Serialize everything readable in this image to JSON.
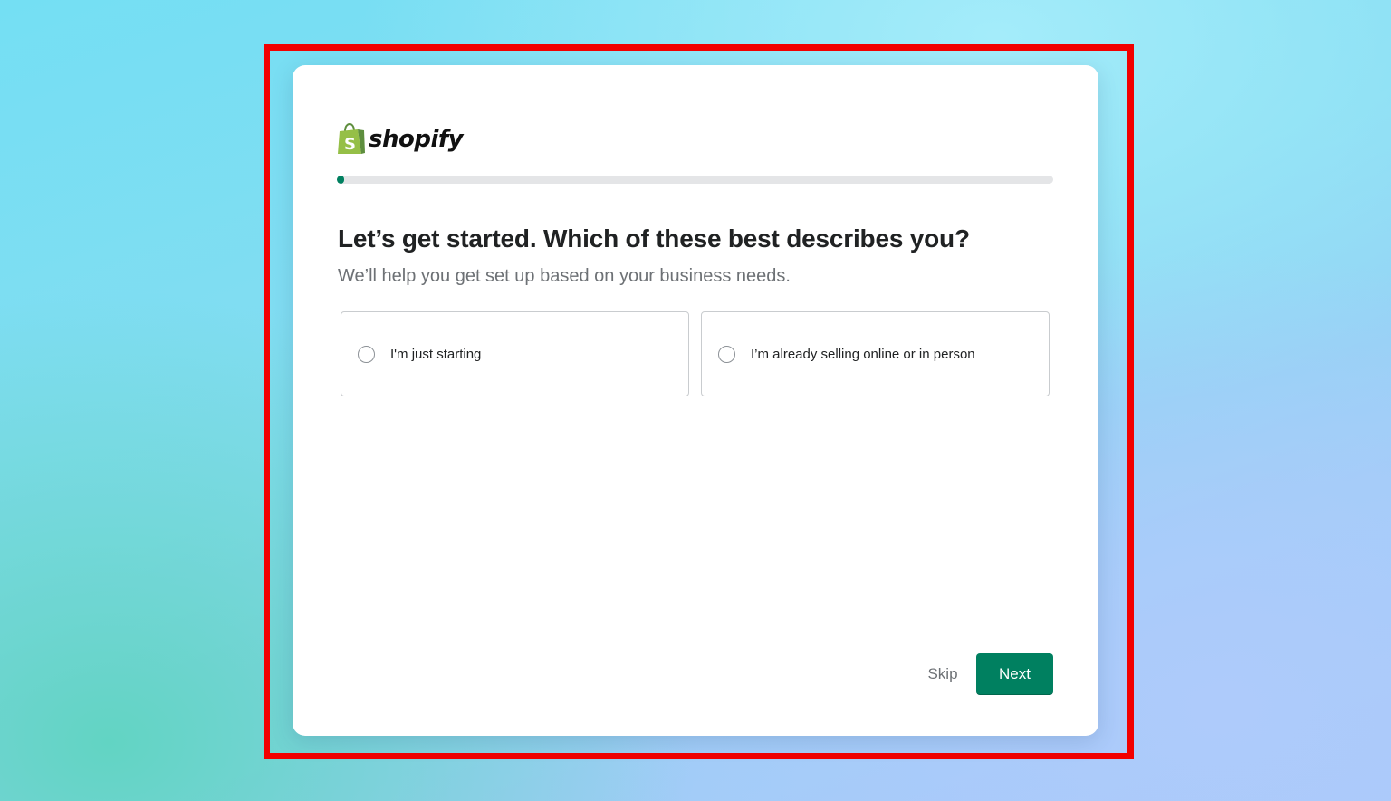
{
  "brand": {
    "logo_text": "shopify",
    "logo_icon": "shopify-bag-icon",
    "colors": {
      "primary": "#008060",
      "bag_light": "#95bf47",
      "bag_dark": "#5e8e3e",
      "highlight_frame": "#f20000"
    }
  },
  "progress": {
    "value_fraction": 0.01
  },
  "question": {
    "title": "Let’s get started. Which of these best describes you?",
    "subtitle": "We’ll help you get set up based on your business needs."
  },
  "options": [
    {
      "label": "I'm just starting",
      "selected": false
    },
    {
      "label": "I’m already selling online or in person",
      "selected": false
    }
  ],
  "actions": {
    "skip_label": "Skip",
    "next_label": "Next"
  }
}
